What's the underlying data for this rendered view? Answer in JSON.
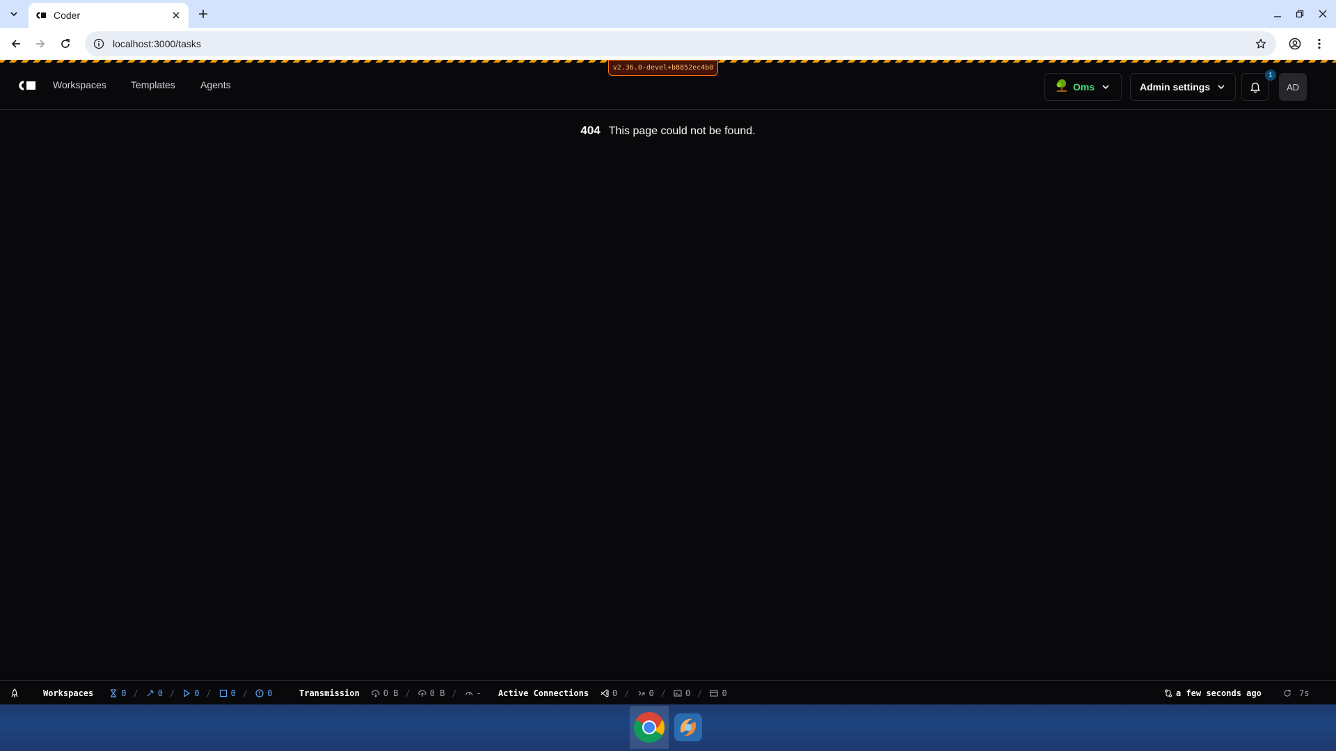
{
  "browser": {
    "tab_title": "Coder",
    "url": "localhost:3000/tasks"
  },
  "app": {
    "version": "v2.36.0-devel+b8852ec4b0",
    "nav": {
      "workspaces": "Workspaces",
      "templates": "Templates",
      "agents": "Agents"
    },
    "org_name": "Oms",
    "admin_label": "Admin settings",
    "notification_count": "1",
    "avatar_initials": "AD",
    "error": {
      "code": "404",
      "message": "This page could not be found."
    }
  },
  "statusbar": {
    "workspaces_label": "Workspaces",
    "pending": "0",
    "starting": "0",
    "running": "0",
    "stopped": "0",
    "failed": "0",
    "transmission_label": "Transmission",
    "download": "0 B",
    "upload": "0 B",
    "latency": "-",
    "connections_label": "Active Connections",
    "vscode": "0",
    "ssh": "0",
    "terminal": "0",
    "apps": "0",
    "updated": "a few seconds ago",
    "refresh": "7s"
  },
  "colors": {
    "accent_green": "#4ade80",
    "status_blue": "#60a5fa",
    "warning_orange": "#f97316"
  }
}
